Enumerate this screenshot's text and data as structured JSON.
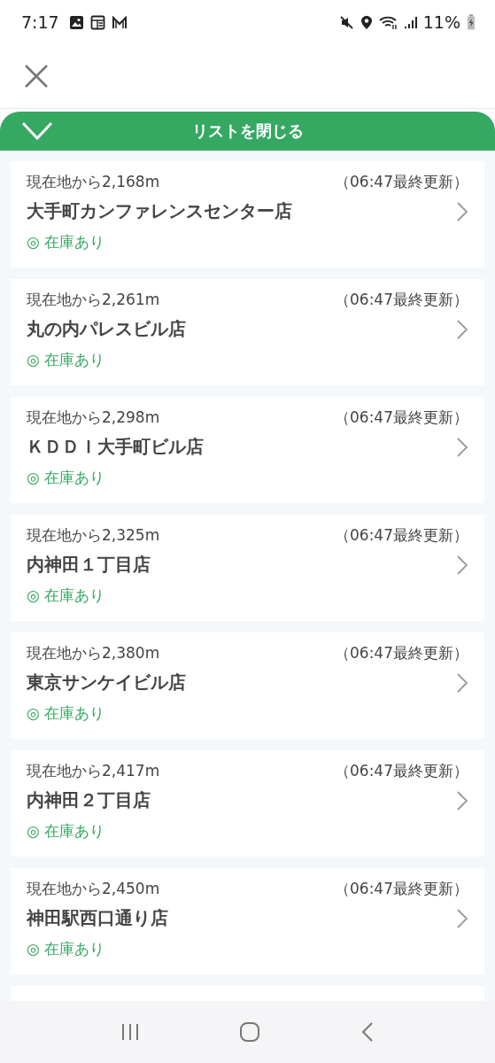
{
  "status_bar": {
    "time": "7:17",
    "battery": "11%"
  },
  "toggle_bar": {
    "label": "リストを閉じる",
    "expanded": true
  },
  "stores": [
    {
      "distance": "現在地から2,168m",
      "updated": "（06:47最終更新）",
      "name": "大手町カンファレンスセンター店",
      "stock": "◎ 在庫あり"
    },
    {
      "distance": "現在地から2,261m",
      "updated": "（06:47最終更新）",
      "name": "丸の内パレスビル店",
      "stock": "◎ 在庫あり"
    },
    {
      "distance": "現在地から2,298m",
      "updated": "（06:47最終更新）",
      "name": "ＫＤＤＩ大手町ビル店",
      "stock": "◎ 在庫あり"
    },
    {
      "distance": "現在地から2,325m",
      "updated": "（06:47最終更新）",
      "name": "内神田１丁目店",
      "stock": "◎ 在庫あり"
    },
    {
      "distance": "現在地から2,380m",
      "updated": "（06:47最終更新）",
      "name": "東京サンケイビル店",
      "stock": "◎ 在庫あり"
    },
    {
      "distance": "現在地から2,417m",
      "updated": "（06:47最終更新）",
      "name": "内神田２丁目店",
      "stock": "◎ 在庫あり"
    },
    {
      "distance": "現在地から2,450m",
      "updated": "（06:47最終更新）",
      "name": "神田駅西口通り店",
      "stock": "◎ 在庫あり"
    }
  ]
}
